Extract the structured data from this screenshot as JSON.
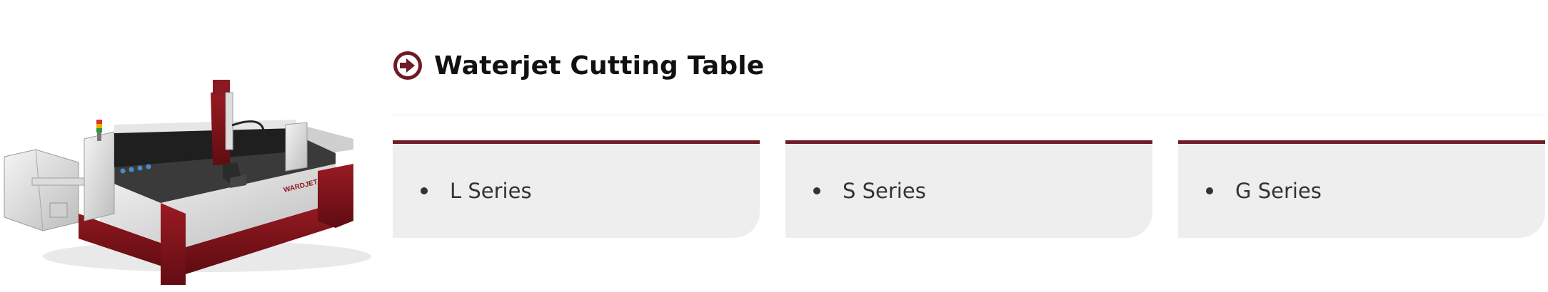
{
  "product": {
    "image_alt": "Waterjet cutting machine",
    "brand_mark": "WARDJET"
  },
  "header": {
    "title": "Waterjet Cutting Table",
    "icon": "circle-arrow-right-icon"
  },
  "series": [
    {
      "label": "L Series"
    },
    {
      "label": "S Series"
    },
    {
      "label": "G Series"
    }
  ],
  "colors": {
    "accent": "#6e1a27",
    "card_bg": "#eeeeee",
    "title": "#111111",
    "text": "#333333"
  }
}
